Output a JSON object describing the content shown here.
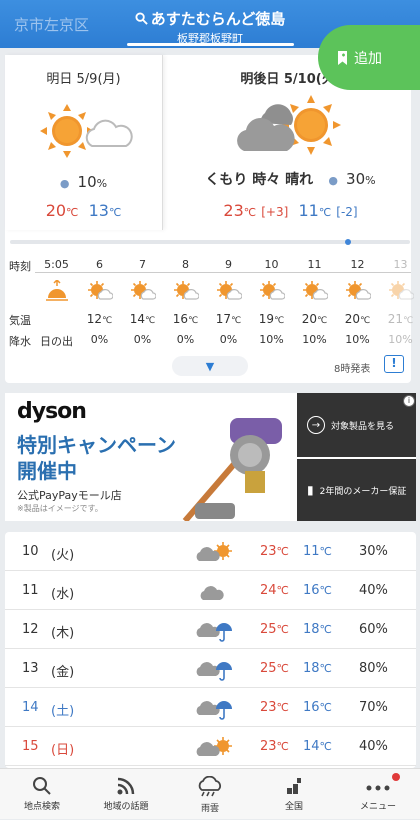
{
  "header": {
    "left_text": "京市左京区",
    "title": "あすたむらんど徳島",
    "subtitle": "板野郡板野町",
    "add_label": "追加"
  },
  "forecast": [
    {
      "title": "明日 5/9(月)",
      "rain": "10",
      "rain_unit": "%",
      "hi": "20",
      "lo": "13",
      "unit": "℃",
      "icon": "sun-cloud-icon"
    },
    {
      "title": "明後日 5/10(火)",
      "condition": "くもり 時々 晴れ",
      "rain": "30",
      "rain_unit": "%",
      "hi": "23",
      "hi_diff": "[+3]",
      "lo": "11",
      "lo_diff": "[-2]",
      "unit": "℃",
      "icon": "cloud-sun-icon"
    }
  ],
  "hourly": {
    "labels": {
      "time": "時刻",
      "temp": "気温",
      "rain": "降水"
    },
    "sunrise_label": "日の出",
    "hours": [
      "5:05",
      "6",
      "7",
      "8",
      "9",
      "10",
      "11",
      "12",
      "13"
    ],
    "temps": [
      "",
      "12",
      "14",
      "16",
      "17",
      "19",
      "20",
      "20",
      "21"
    ],
    "rain": [
      "",
      "0%",
      "0%",
      "0%",
      "0%",
      "10%",
      "10%",
      "10%",
      "10%"
    ],
    "issued": "8時発表",
    "expand_icon": "triangle-down-icon"
  },
  "ad": {
    "logo": "dyson",
    "headline1": "特別キャンペーン",
    "headline2": "開催中",
    "shop": "公式PayPayモール店",
    "note": "※製品はイメージです。",
    "link1": "対象製品を見る",
    "link2": "2年間のメーカー保証"
  },
  "weekly": [
    {
      "date": "10",
      "weekday": "(火)",
      "type": "",
      "hi": "23",
      "lo": "11",
      "rain": "30%",
      "icon": "cloud-sun-icon"
    },
    {
      "date": "11",
      "weekday": "(水)",
      "type": "",
      "hi": "24",
      "lo": "16",
      "rain": "40%",
      "icon": "cloud-icon"
    },
    {
      "date": "12",
      "weekday": "(木)",
      "type": "",
      "hi": "25",
      "lo": "18",
      "rain": "60%",
      "icon": "cloud-umbrella-icon"
    },
    {
      "date": "13",
      "weekday": "(金)",
      "type": "",
      "hi": "25",
      "lo": "18",
      "rain": "80%",
      "icon": "cloud-umbrella-icon"
    },
    {
      "date": "14",
      "weekday": "(土)",
      "type": "sat",
      "hi": "23",
      "lo": "16",
      "rain": "70%",
      "icon": "cloud-umbrella-icon"
    },
    {
      "date": "15",
      "weekday": "(日)",
      "type": "sun",
      "hi": "23",
      "lo": "14",
      "rain": "40%",
      "icon": "cloud-sun-icon"
    }
  ],
  "tabs": [
    "地点検索",
    "地域の話題",
    "雨雲",
    "全国",
    "メニュー"
  ],
  "colors": {
    "primary": "#2d7dd3",
    "hot": "#d9493b",
    "cold": "#3f79c4",
    "add": "#5cc35a"
  }
}
